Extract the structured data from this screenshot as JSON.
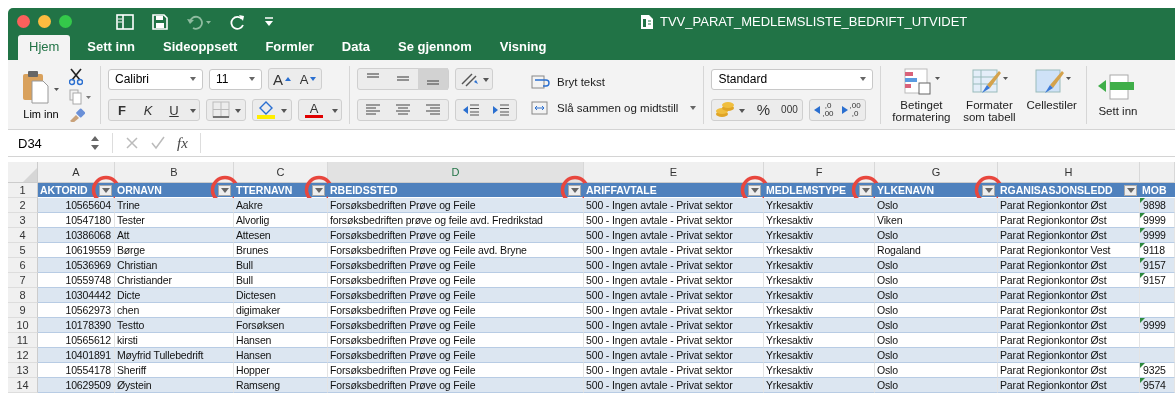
{
  "window": {
    "title": "TVV_PARAT_MEDLEMSLISTE_BEDRIFT_UTVIDET"
  },
  "tabs": [
    {
      "label": "Hjem",
      "selected": true
    },
    {
      "label": "Sett inn",
      "selected": false
    },
    {
      "label": "Sideoppsett",
      "selected": false
    },
    {
      "label": "Formler",
      "selected": false
    },
    {
      "label": "Data",
      "selected": false
    },
    {
      "label": "Se gjennom",
      "selected": false
    },
    {
      "label": "Visning",
      "selected": false
    }
  ],
  "ribbon": {
    "paste": {
      "label": "Lim inn"
    },
    "font": {
      "name": "Calibri",
      "size": "11",
      "grow": "A",
      "shrink": "A",
      "bold": "F",
      "italic": "K",
      "underline": "U",
      "font_color": "A"
    },
    "vertical_align": [
      {
        "selected": false
      },
      {
        "selected": false
      },
      {
        "selected": true
      }
    ],
    "alignment": {
      "wrap_text": "Bryt tekst",
      "merge": "Slå sammen og midtstill"
    },
    "number": {
      "format": "Standard",
      "percent": "%",
      "thousands": "000",
      "increase_decimals": [
        ",0",
        ",00"
      ],
      "decrease_decimals": [
        ",00",
        ",0"
      ]
    },
    "styles": [
      {
        "label": "Betinget formatering",
        "kind": "conditional"
      },
      {
        "label": "Formater som tabell",
        "kind": "table"
      },
      {
        "label": "Cellestiler",
        "kind": "cellstyle"
      }
    ],
    "cells": {
      "insert": "Sett inn"
    }
  },
  "formula_bar": {
    "cell_reference": "D34",
    "function_label": "fx"
  },
  "sheet": {
    "header_row_number": "1",
    "columns": [
      {
        "letter": "A",
        "header": "AKTORID",
        "filter": true,
        "highlighted": true,
        "selected": false
      },
      {
        "letter": "B",
        "header": "ORNAVN",
        "filter": true,
        "highlighted": true,
        "selected": false
      },
      {
        "letter": "C",
        "header": "TTERNAVN",
        "filter": true,
        "highlighted": true,
        "selected": false
      },
      {
        "letter": "D",
        "header": "RBEIDSSTED",
        "filter": true,
        "highlighted": true,
        "selected": true
      },
      {
        "letter": "E",
        "header": "ARIFFAVTALE",
        "filter": true,
        "highlighted": true,
        "selected": false
      },
      {
        "letter": "F",
        "header": "MEDLEMSTYPE",
        "filter": true,
        "highlighted": true,
        "selected": false
      },
      {
        "letter": "G",
        "header": "YLKENAVN",
        "filter": true,
        "highlighted": true,
        "selected": false
      },
      {
        "letter": "H",
        "header": "RGANISASJONSLEDD",
        "filter": true,
        "highlighted": false,
        "selected": false
      },
      {
        "header": "MOB",
        "filter": false,
        "highlighted": false,
        "selected": false
      }
    ],
    "rows": [
      {
        "number": "2",
        "cells": [
          "10565604",
          "Trine",
          "Aakre",
          "Forsøksbedriften Prøve og Feile",
          "500 - Ingen avtale - Privat sektor",
          "Yrkesaktiv",
          "Oslo",
          "Parat Regionkontor Øst",
          "9898"
        ],
        "flagged": true
      },
      {
        "number": "3",
        "cells": [
          "10547180",
          "Tester",
          "Alvorlig",
          "forsøksbedriften prøve og feile avd. Fredrikstad",
          "500 - Ingen avtale - Privat sektor",
          "Yrkesaktiv",
          "Viken",
          "Parat Regionkontor Øst",
          "9999"
        ],
        "flagged": true
      },
      {
        "number": "4",
        "cells": [
          "10386068",
          "Att",
          "Attesen",
          "Forsøksbedriften Prøve og Feile",
          "500 - Ingen avtale - Privat sektor",
          "Yrkesaktiv",
          "Oslo",
          "Parat Regionkontor Øst",
          "9999"
        ],
        "flagged": true
      },
      {
        "number": "5",
        "cells": [
          "10619559",
          "Børge",
          "Brunes",
          "Forsøksbedriften Prøve og Feile avd. Bryne",
          "500 - Ingen avtale - Privat sektor",
          "Yrkesaktiv",
          "Rogaland",
          "Parat Regionkontor Vest",
          "9118"
        ],
        "flagged": true
      },
      {
        "number": "6",
        "cells": [
          "10536969",
          "Christian",
          "Bull",
          "Forsøksbedriften Prøve og Feile",
          "500 - Ingen avtale - Privat sektor",
          "Yrkesaktiv",
          "Oslo",
          "Parat Regionkontor Øst",
          "9157"
        ],
        "flagged": true
      },
      {
        "number": "7",
        "cells": [
          "10559748",
          "Christiander",
          "Bull",
          "Forsøksbedriften Prøve og Feile",
          "500 - Ingen avtale - Privat sektor",
          "Yrkesaktiv",
          "Oslo",
          "Parat Regionkontor Øst",
          "9157"
        ],
        "flagged": true
      },
      {
        "number": "8",
        "cells": [
          "10304442",
          "Dicte",
          "Dictesen",
          "Forsøksbedriften Prøve og Feile",
          "500 - Ingen avtale - Privat sektor",
          "Yrkesaktiv",
          "Oslo",
          "Parat Regionkontor Øst"
        ],
        "flagged": false
      },
      {
        "number": "9",
        "cells": [
          "10562973",
          "chen",
          "digimaker",
          "Forsøksbedriften Prøve og Feile",
          "500 - Ingen avtale - Privat sektor",
          "Yrkesaktiv",
          "Oslo",
          "Parat Regionkontor Øst"
        ],
        "flagged": false
      },
      {
        "number": "10",
        "cells": [
          "10178390",
          "Testto",
          "Forsøksen",
          "Forsøksbedriften Prøve og Feile",
          "500 - Ingen avtale - Privat sektor",
          "Yrkesaktiv",
          "Oslo",
          "Parat Regionkontor Øst",
          "9999"
        ],
        "flagged": true
      },
      {
        "number": "11",
        "cells": [
          "10565612",
          "kirsti",
          "Hansen",
          "Forsøksbedriften Prøve og Feile",
          "500 - Ingen avtale - Privat sektor",
          "Yrkesaktiv",
          "Oslo",
          "Parat Regionkontor Øst"
        ],
        "flagged": false
      },
      {
        "number": "12",
        "cells": [
          "10401891",
          "Møyfrid Tullebedrift",
          "Hansen",
          "Forsøksbedriften Prøve og Feile",
          "500 - Ingen avtale - Privat sektor",
          "Yrkesaktiv",
          "Oslo",
          "Parat Regionkontor Øst"
        ],
        "flagged": false
      },
      {
        "number": "13",
        "cells": [
          "10554178",
          "Sheriff",
          "Hopper",
          "Forsøksbedriften Prøve og Feile",
          "500 - Ingen avtale - Privat sektor",
          "Yrkesaktiv",
          "Oslo",
          "Parat Regionkontor Øst",
          "9325"
        ],
        "flagged": true
      },
      {
        "number": "14",
        "cells": [
          "10629509",
          "Øystein",
          "Ramseng",
          "Forsøksbedriften Prøve og Feile",
          "500 - Ingen avtale - Privat sektor",
          "Yrkesaktiv",
          "Oslo",
          "Parat Regionkontor Øst",
          "9574"
        ],
        "flagged": true
      }
    ]
  }
}
